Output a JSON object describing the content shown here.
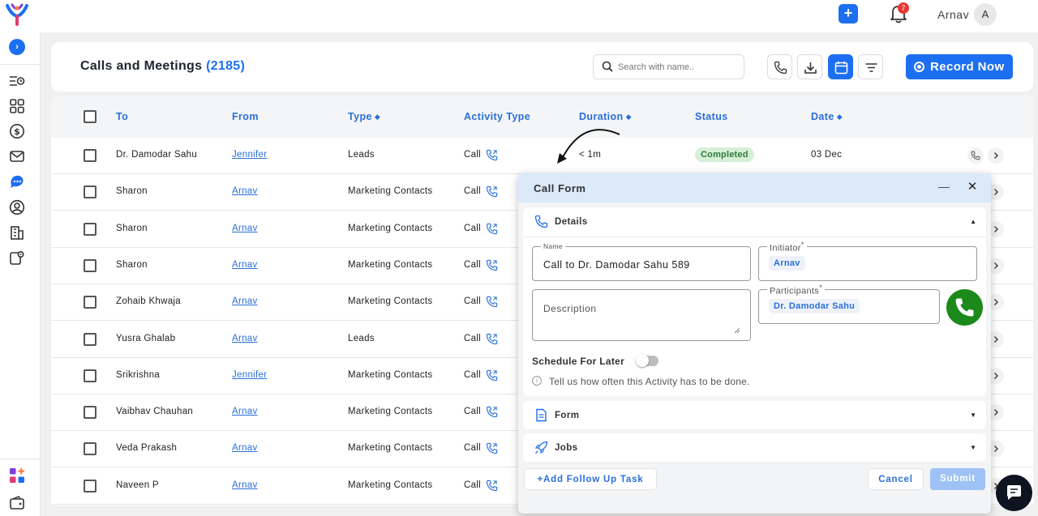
{
  "topbar": {
    "notification_count": "7",
    "user_name": "Arnav",
    "avatar_initial": "A"
  },
  "header": {
    "title": "Calls and Meetings",
    "count": "(2185)",
    "search_placeholder": "Search with name..",
    "record_label": "Record Now"
  },
  "table": {
    "columns": [
      "To",
      "From",
      "Type",
      "Activity Type",
      "Duration",
      "Status",
      "Date"
    ],
    "rows": [
      {
        "to": "Dr. Damodar Sahu",
        "from": "Jennifer",
        "type": "Leads",
        "activity": "Call",
        "duration": "< 1m",
        "status": "Completed",
        "date": "03 Dec"
      },
      {
        "to": "Sharon",
        "from": "Arnav",
        "type": "Marketing Contacts",
        "activity": "Call"
      },
      {
        "to": "Sharon",
        "from": "Arnav",
        "type": "Marketing Contacts",
        "activity": "Call"
      },
      {
        "to": "Sharon",
        "from": "Arnav",
        "type": "Marketing Contacts",
        "activity": "Call"
      },
      {
        "to": "Zohaib Khwaja",
        "from": "Arnav",
        "type": "Marketing Contacts",
        "activity": "Call"
      },
      {
        "to": "Yusra Ghalab",
        "from": "Arnav",
        "type": "Leads",
        "activity": "Call"
      },
      {
        "to": "Srikrishna",
        "from": "Jennifer",
        "type": "Marketing Contacts",
        "activity": "Call"
      },
      {
        "to": "Vaibhav Chauhan",
        "from": "Arnav",
        "type": "Marketing Contacts",
        "activity": "Call"
      },
      {
        "to": "Veda Prakash",
        "from": "Arnav",
        "type": "Marketing Contacts",
        "activity": "Call"
      },
      {
        "to": "Naveen P",
        "from": "Arnav",
        "type": "Marketing Contacts",
        "activity": "Call"
      }
    ]
  },
  "modal": {
    "title": "Call Form",
    "details_title": "Details",
    "name_label": "Name",
    "name_value": "Call to Dr. Damodar Sahu 589",
    "initiator_label": "Initiator",
    "initiator_value": "Arnav",
    "description_label": "Description",
    "participants_label": "Participants",
    "participant_value": "Dr. Damodar Sahu",
    "schedule_label": "Schedule For Later",
    "hint": "Tell us how often this Activity has to be done.",
    "form_title": "Form",
    "jobs_title": "Jobs",
    "follow_up_label": "Add Follow Up Task",
    "cancel_label": "Cancel",
    "submit_label": "Submit"
  },
  "colors": {
    "accent": "#1d6ff2",
    "link": "#2a6fdb",
    "success_bg": "#d6efd8",
    "success_text": "#2d7c37",
    "call_green": "#1b8a1b"
  }
}
